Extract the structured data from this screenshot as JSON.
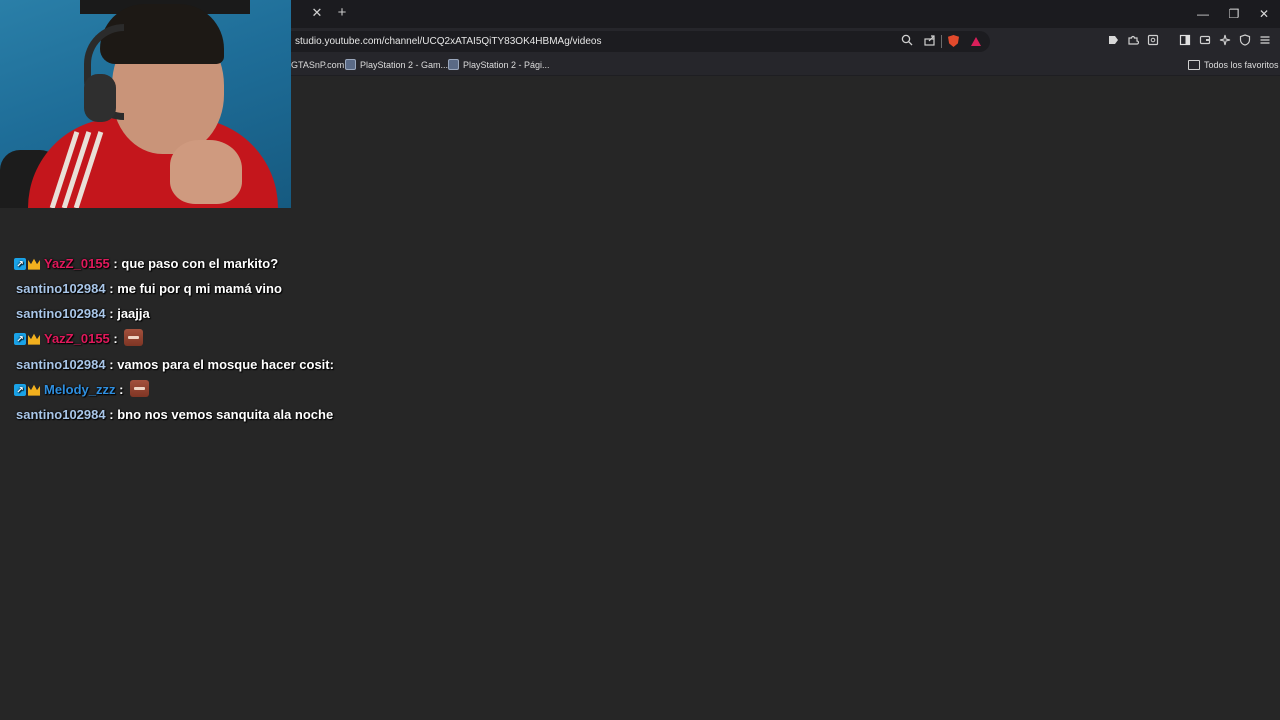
{
  "browser": {
    "url": "studio.youtube.com/channel/UCQ2xATAI5QiTY83OK4HBMAg/videos",
    "tab_close_glyph": "✕",
    "new_tab_glyph": "+",
    "window_controls": {
      "minimize": "—",
      "restore": "❐",
      "close": "✕"
    },
    "bookmarks": [
      {
        "label": "GTASnP.com"
      },
      {
        "label": "PlayStation 2 - Gam..."
      },
      {
        "label": "PlayStation 2 - Pági..."
      }
    ],
    "all_bookmarks_label": "Todos los favoritos",
    "icons": {
      "zoom": "search-icon",
      "share": "share-icon",
      "brave_shields": "brave-lion-icon",
      "brave_rewards": "brave-bat-icon",
      "leo": "leo-icon",
      "extensions": "puzzle-icon",
      "screenshot": "screenshot-icon",
      "sidebar": "sidebar-icon",
      "wallet": "wallet-icon",
      "ai": "sparkle-icon",
      "vpn": "shield-icon",
      "menu": "hamburger-icon"
    },
    "colors": {
      "titlebar": "#1b1b1f",
      "toolbar": "#26262b",
      "page": "#262626"
    }
  },
  "chat": {
    "messages": [
      {
        "badges": [
          "boost",
          "crown"
        ],
        "username": "YazZ_0155",
        "color": "#e0195b",
        "text": "que paso con el markito?"
      },
      {
        "badges": [],
        "username": "santino102984",
        "color": "#a9c6e8",
        "text": "me fui por q mi mamá vino"
      },
      {
        "badges": [],
        "username": "santino102984",
        "color": "#a9c6e8",
        "text": "jaajja"
      },
      {
        "badges": [
          "boost",
          "crown"
        ],
        "username": "YazZ_0155",
        "color": "#e0195b",
        "text": "",
        "emote": "emote-icon"
      },
      {
        "badges": [],
        "username": "santino102984",
        "color": "#a9c6e8",
        "text": "vamos para el mosque hacer cosit:"
      },
      {
        "badges": [
          "boost",
          "crown"
        ],
        "username": "Melody_zzz",
        "color": "#2f8fe0",
        "text": "",
        "emote": "emote-icon"
      },
      {
        "badges": [],
        "username": "santino102984",
        "color": "#a9c6e8",
        "text": "bno nos vemos sanquita ala noche"
      }
    ],
    "separator": ":",
    "badge_colors": {
      "boost": "#1aa3e8",
      "crown": "#f2b01e"
    }
  }
}
